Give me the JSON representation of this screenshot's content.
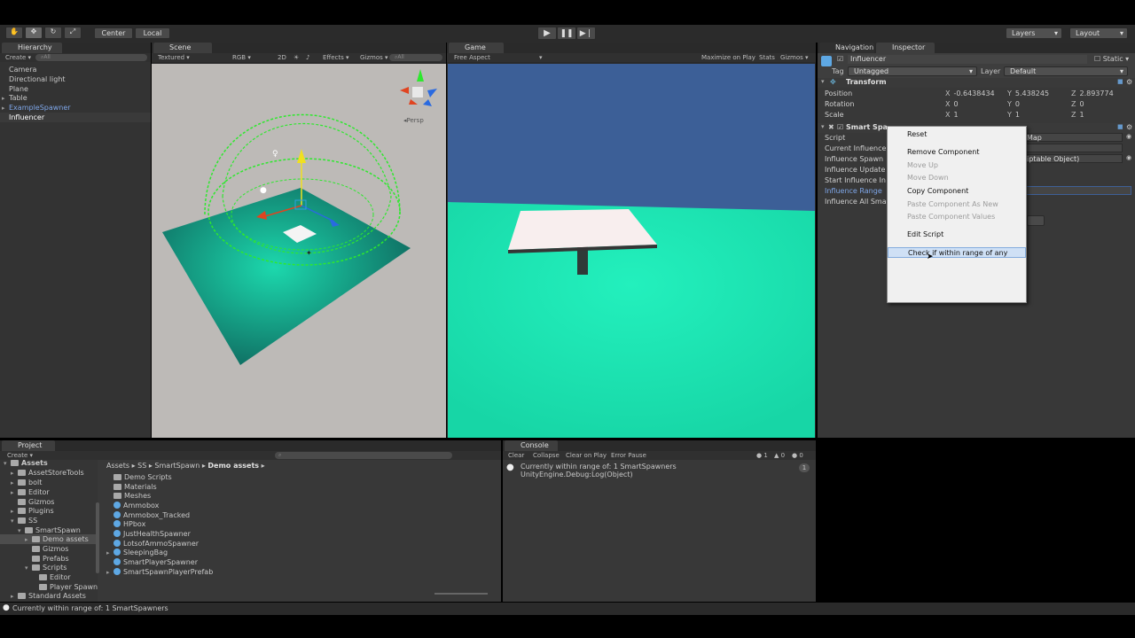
{
  "toolbar": {
    "pivot_label": "Center",
    "space_label": "Local",
    "layers_label": "Layers",
    "layout_label": "Layout"
  },
  "hierarchy": {
    "tab_label": "Hierarchy",
    "create_label": "Create",
    "search_placeholder": "All",
    "items": [
      "Camera",
      "Directional light",
      "Plane",
      "Table",
      "ExampleSpawner",
      "Influencer"
    ]
  },
  "scene": {
    "tab_label": "Scene",
    "shading": "Textured",
    "render_mode": "RGB",
    "mode_2d": "2D",
    "effects_label": "Effects",
    "gizmos_label": "Gizmos",
    "search_placeholder": "All",
    "persp_label": "Persp"
  },
  "game": {
    "tab_label": "Game",
    "aspect": "Free Aspect",
    "maximize_label": "Maximize on Play",
    "stats_label": "Stats",
    "gizmos_label": "Gizmos"
  },
  "inspector": {
    "nav_tab_label": "Navigation",
    "tab_label": "Inspector",
    "object_name": "Influencer",
    "static_label": "Static",
    "tag_label": "Tag",
    "tag_value": "Untagged",
    "layer_label": "Layer",
    "layer_value": "Default",
    "transform_title": "Transform",
    "position_label": "Position",
    "position": {
      "x": "-0.6438434",
      "y": "5.438245",
      "z": "2.893774"
    },
    "rotation_label": "Rotation",
    "rotation": {
      "x": "0",
      "y": "0",
      "z": "0"
    },
    "scale_label": "Scale",
    "scale": {
      "x": "1",
      "y": "1",
      "z": "1"
    },
    "component_title": "Smart Spa",
    "fields": [
      "Script",
      "Current Influence",
      "Influence Spawn",
      "Influence Update",
      "Start Influence In",
      "Influence Range",
      "Influence All Sma"
    ],
    "script_value_tail": "Map",
    "spawn_value_tail": "iptable Object)"
  },
  "context_menu": {
    "items": [
      {
        "label": "Reset",
        "enabled": true
      },
      {
        "label": "Remove Component",
        "enabled": true
      },
      {
        "label": "Move Up",
        "enabled": false
      },
      {
        "label": "Move Down",
        "enabled": false
      },
      {
        "label": "Copy Component",
        "enabled": true
      },
      {
        "label": "Paste Component As New",
        "enabled": false
      },
      {
        "label": "Paste Component Values",
        "enabled": false
      },
      {
        "label": "Edit Script",
        "enabled": true
      },
      {
        "label": "Check if within range of any",
        "enabled": true,
        "highlighted": true
      }
    ]
  },
  "project": {
    "tab_label": "Project",
    "create_label": "Create",
    "tree": [
      "Assets",
      "AssetStoreTools",
      "bolt",
      "Editor",
      "Gizmos",
      "Plugins",
      "SS",
      "SmartSpawn",
      "Demo assets",
      "Gizmos",
      "Prefabs",
      "Scripts",
      "Editor",
      "Player Spawn",
      "Standard Assets"
    ],
    "breadcrumb": [
      "Assets",
      "SS",
      "SmartSpawn",
      "Demo assets"
    ],
    "files": [
      "Demo Scripts",
      "Materials",
      "Meshes",
      "Ammobox",
      "Ammobox_Tracked",
      "HPbox",
      "JustHealthSpawner",
      "LotsofAmmoSpawner",
      "SleepingBag",
      "SmartPlayerSpawner",
      "SmartSpawnPlayerPrefab"
    ]
  },
  "console": {
    "tab_label": "Console",
    "clear_label": "Clear",
    "collapse_label": "Collapse",
    "clear_on_play_label": "Clear on Play",
    "error_pause_label": "Error Pause",
    "info_count": "1",
    "warn_count": "0",
    "error_count": "0",
    "message_line1": "Currently within range of: 1 SmartSpawners",
    "message_line2": "UnityEngine.Debug:Log(Object)",
    "message_count": "1"
  },
  "status_bar": {
    "text": "Currently within range of: 1 SmartSpawners"
  },
  "colors": {
    "sky": "#3c5f97",
    "ground": "#1de0b0",
    "selection": "#3e5f96"
  }
}
